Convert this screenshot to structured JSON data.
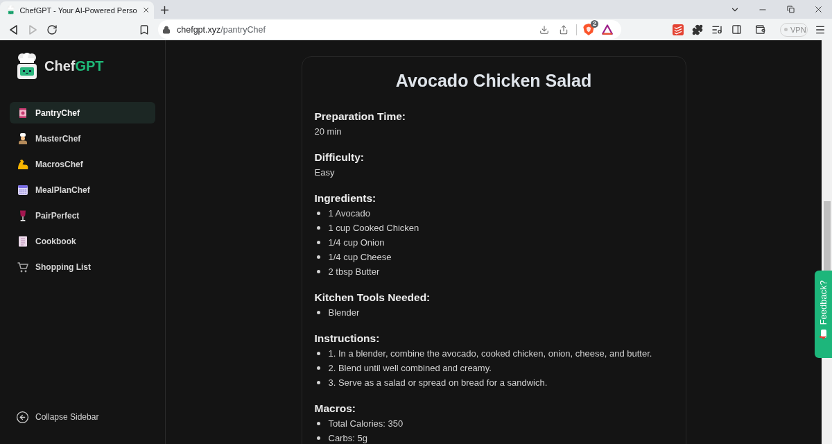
{
  "browser": {
    "tab": {
      "title": "ChefGPT - Your AI-Powered Perso"
    },
    "forward": {
      "disabled": true
    },
    "address": {
      "host": "chefgpt.xyz",
      "path": "/pantryChef"
    },
    "shields_count": "2",
    "vpn": {
      "label": "VPN",
      "on": false
    }
  },
  "sidebar": {
    "logo": {
      "text": "Chef",
      "accent": "GPT"
    },
    "items": [
      {
        "label": "PantryChef",
        "selected": true
      },
      {
        "label": "MasterChef",
        "selected": false
      },
      {
        "label": "MacrosChef",
        "selected": false
      },
      {
        "label": "MealPlanChef",
        "selected": false
      },
      {
        "label": "PairPerfect",
        "selected": false
      },
      {
        "label": "Cookbook",
        "selected": false
      },
      {
        "label": "Shopping List",
        "selected": false
      }
    ],
    "collapse": "Collapse Sidebar"
  },
  "recipe": {
    "title": "Avocado Chicken Salad",
    "sections": [
      {
        "kind": "text",
        "heading": "Preparation Time:",
        "text": "20 min"
      },
      {
        "kind": "text",
        "heading": "Difficulty:",
        "text": "Easy"
      },
      {
        "kind": "list",
        "heading": "Ingredients:",
        "items": [
          "1 Avocado",
          "1 cup Cooked Chicken",
          "1/4 cup Onion",
          "1/4 cup Cheese",
          "2 tbsp Butter"
        ]
      },
      {
        "kind": "list",
        "heading": "Kitchen Tools Needed:",
        "items": [
          "Blender"
        ]
      },
      {
        "kind": "list",
        "heading": "Instructions:",
        "items": [
          "1. In a blender, combine the avocado, cooked chicken, onion, cheese, and butter.",
          "2. Blend until well combined and creamy.",
          "3. Serve as a salad or spread on bread for a sandwich."
        ]
      },
      {
        "kind": "list",
        "heading": "Macros:",
        "items": [
          "Total Calories: 350",
          "Carbs: 5g"
        ]
      }
    ]
  },
  "feedback": {
    "label": "Feedback?"
  }
}
